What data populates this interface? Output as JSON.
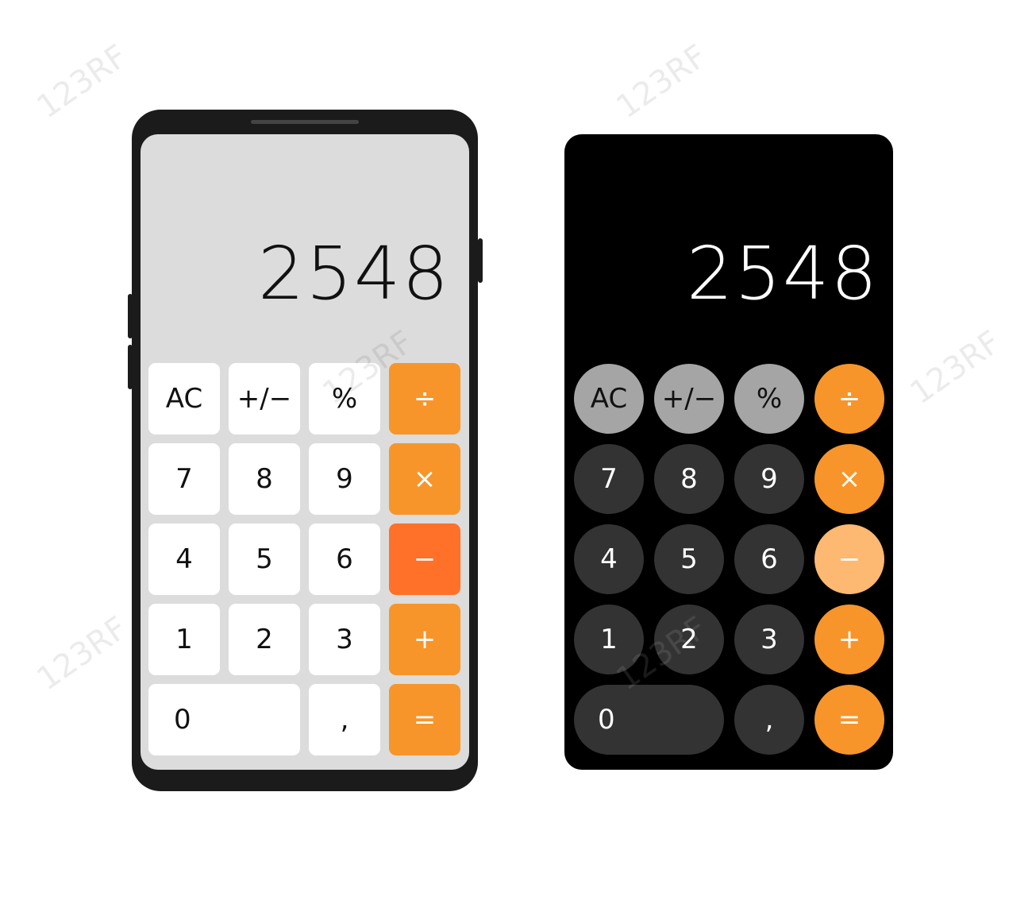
{
  "light_calculator": {
    "display": "2548",
    "keys": [
      {
        "label": "AC",
        "name": "key-ac"
      },
      {
        "label": "+/−",
        "name": "key-plus-minus"
      },
      {
        "label": "%",
        "name": "key-percent"
      },
      {
        "label": "÷",
        "name": "key-divide"
      },
      {
        "label": "7",
        "name": "key-7"
      },
      {
        "label": "8",
        "name": "key-8"
      },
      {
        "label": "9",
        "name": "key-9"
      },
      {
        "label": "×",
        "name": "key-multiply"
      },
      {
        "label": "4",
        "name": "key-4"
      },
      {
        "label": "5",
        "name": "key-5"
      },
      {
        "label": "6",
        "name": "key-6"
      },
      {
        "label": "−",
        "name": "key-minus"
      },
      {
        "label": "1",
        "name": "key-1"
      },
      {
        "label": "2",
        "name": "key-2"
      },
      {
        "label": "3",
        "name": "key-3"
      },
      {
        "label": "+",
        "name": "key-plus"
      },
      {
        "label": "0",
        "name": "key-0"
      },
      {
        "label": ",",
        "name": "key-comma"
      },
      {
        "label": "=",
        "name": "key-equals"
      }
    ]
  },
  "dark_calculator": {
    "display": "2548",
    "keys": [
      {
        "label": "AC",
        "name": "key-ac"
      },
      {
        "label": "+/−",
        "name": "key-plus-minus"
      },
      {
        "label": "%",
        "name": "key-percent"
      },
      {
        "label": "÷",
        "name": "key-divide"
      },
      {
        "label": "7",
        "name": "key-7"
      },
      {
        "label": "8",
        "name": "key-8"
      },
      {
        "label": "9",
        "name": "key-9"
      },
      {
        "label": "×",
        "name": "key-multiply"
      },
      {
        "label": "4",
        "name": "key-4"
      },
      {
        "label": "5",
        "name": "key-5"
      },
      {
        "label": "6",
        "name": "key-6"
      },
      {
        "label": "−",
        "name": "key-minus"
      },
      {
        "label": "1",
        "name": "key-1"
      },
      {
        "label": "2",
        "name": "key-2"
      },
      {
        "label": "3",
        "name": "key-3"
      },
      {
        "label": "+",
        "name": "key-plus"
      },
      {
        "label": "0",
        "name": "key-0"
      },
      {
        "label": ",",
        "name": "key-comma"
      },
      {
        "label": "=",
        "name": "key-equals"
      }
    ]
  },
  "colors": {
    "operator": "#f7952a",
    "operator_active_light": "#ff7128",
    "operator_active_dark": "#fdb872",
    "function_dark": "#a5a5a5",
    "digit_dark": "#333333",
    "screen_light": "#dcdcdc"
  },
  "watermark": "123RF"
}
